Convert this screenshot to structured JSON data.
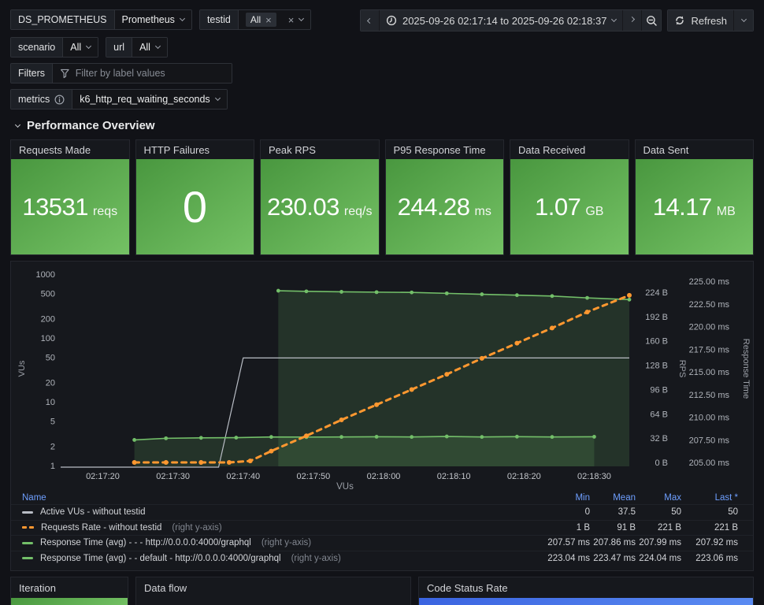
{
  "header": {
    "ds_label": "DS_PROMETHEUS",
    "ds_value": "Prometheus",
    "testid_label": "testid",
    "testid_chip": "All",
    "scenario_label": "scenario",
    "scenario_value": "All",
    "url_label": "url",
    "url_value": "All",
    "filters_label": "Filters",
    "filters_placeholder": "Filter by label values",
    "metrics_label": "metrics",
    "metrics_value": "k6_http_req_waiting_seconds",
    "time_range": "2025-09-26 02:17:14 to 2025-09-26 02:18:37",
    "refresh_label": "Refresh"
  },
  "section": {
    "title": "Performance Overview"
  },
  "stats": [
    {
      "title": "Requests Made",
      "value": "13531",
      "unit": "reqs"
    },
    {
      "title": "HTTP Failures",
      "value": "0",
      "unit": ""
    },
    {
      "title": "Peak RPS",
      "value": "230.03",
      "unit": "req/s"
    },
    {
      "title": "P95 Response Time",
      "value": "244.28",
      "unit": "ms"
    },
    {
      "title": "Data Received",
      "value": "1.07",
      "unit": "GB"
    },
    {
      "title": "Data Sent",
      "value": "14.17",
      "unit": "MB"
    }
  ],
  "chart_data": {
    "type": "line",
    "x_axis": {
      "start": "02:17:14",
      "end": "02:18:35",
      "duration_seconds": 81,
      "tick_labels": [
        "02:17:20",
        "02:17:30",
        "02:17:40",
        "02:17:50",
        "02:18:00",
        "02:18:10",
        "02:18:20",
        "02:18:30"
      ],
      "tick_seconds": [
        6,
        16,
        26,
        36,
        46,
        56,
        66,
        76
      ],
      "title": "VUs"
    },
    "left_axis": {
      "title": "VUs",
      "scale": "log",
      "tick_values": [
        1000,
        500,
        200,
        100,
        50,
        20,
        10,
        5,
        2,
        1
      ],
      "max_value": 1120
    },
    "rps_axis": {
      "title": "RPS",
      "tick_labels": [
        "224 B",
        "192 B",
        "160 B",
        "128 B",
        "96 B",
        "64 B",
        "32 B",
        "0 B"
      ],
      "tick_values": [
        224,
        192,
        160,
        128,
        96,
        64,
        32,
        0
      ]
    },
    "ms_axis": {
      "title": "Response Time",
      "tick_labels": [
        "225.00 ms",
        "222.50 ms",
        "220.00 ms",
        "217.50 ms",
        "215.00 ms",
        "212.50 ms",
        "210.00 ms",
        "207.50 ms",
        "205.00 ms"
      ],
      "tick_values": [
        225,
        222.5,
        220,
        217.5,
        215,
        212.5,
        210,
        207.5,
        205
      ],
      "min": 205
    },
    "series": [
      {
        "name": "Active VUs - without testid",
        "axis": "vus",
        "color": "#b9bdc5",
        "style": "line",
        "width": 1.2,
        "points": [
          [
            0,
            0
          ],
          [
            22.5,
            0
          ],
          [
            26,
            50
          ],
          [
            81,
            50
          ]
        ]
      },
      {
        "name": "Requests Rate - without testid",
        "axis": "rps",
        "color": "#ff9830",
        "style": "dashed",
        "width": 3,
        "points": [
          [
            10.5,
            1
          ],
          [
            15,
            1
          ],
          [
            20,
            1
          ],
          [
            24,
            1
          ],
          [
            27,
            3
          ],
          [
            30,
            16
          ],
          [
            35,
            36
          ],
          [
            40,
            57
          ],
          [
            45,
            77
          ],
          [
            50,
            97
          ],
          [
            55,
            117
          ],
          [
            60,
            138
          ],
          [
            65,
            158
          ],
          [
            70,
            178
          ],
          [
            75,
            199
          ],
          [
            81,
            221
          ]
        ]
      },
      {
        "name": "Response Time (avg) - - - http://0.0.0.0:4000/graphql",
        "axis": "ms",
        "color": "#73bf69",
        "style": "area",
        "width": 1.6,
        "fill_opacity": 0.16,
        "points": [
          [
            10.5,
            207.57
          ],
          [
            15,
            207.75
          ],
          [
            20,
            207.8
          ],
          [
            25,
            207.82
          ],
          [
            30,
            207.9
          ],
          [
            35,
            207.88
          ],
          [
            40,
            207.9
          ],
          [
            45,
            207.92
          ],
          [
            50,
            207.9
          ],
          [
            55,
            207.95
          ],
          [
            60,
            207.9
          ],
          [
            65,
            207.93
          ],
          [
            70,
            207.9
          ],
          [
            76,
            207.92
          ]
        ]
      },
      {
        "name": "Response Time (avg) - - default - http://0.0.0.0:4000/graphql",
        "axis": "ms",
        "color": "#73bf69",
        "style": "area",
        "width": 1.6,
        "fill_opacity": 0.16,
        "points": [
          [
            31,
            224.04
          ],
          [
            35,
            223.97
          ],
          [
            40,
            223.92
          ],
          [
            45,
            223.88
          ],
          [
            50,
            223.85
          ],
          [
            55,
            223.75
          ],
          [
            60,
            223.65
          ],
          [
            65,
            223.55
          ],
          [
            70,
            223.45
          ],
          [
            75,
            223.25
          ],
          [
            81,
            223.06
          ]
        ]
      }
    ]
  },
  "legend": {
    "columns": {
      "name": "Name",
      "min": "Min",
      "mean": "Mean",
      "max": "Max",
      "last": "Last *"
    },
    "rows": [
      {
        "swatch": "gray-line",
        "name": "Active VUs - without testid",
        "suffix": "",
        "min": "0",
        "mean": "37.5",
        "max": "50",
        "last": "50"
      },
      {
        "swatch": "orange-dash",
        "name": "Requests Rate - without testid",
        "suffix": "(right y-axis)",
        "min": "1 B",
        "mean": "91 B",
        "max": "221 B",
        "last": "221 B"
      },
      {
        "swatch": "green-line",
        "name": "Response Time (avg) - - - http://0.0.0.0:4000/graphql",
        "suffix": "(right y-axis)",
        "min": "207.57 ms",
        "mean": "207.86 ms",
        "max": "207.99 ms",
        "last": "207.92 ms"
      },
      {
        "swatch": "green-line",
        "name": "Response Time (avg) - - default - http://0.0.0.0:4000/graphql",
        "suffix": "(right y-axis)",
        "min": "223.04 ms",
        "mean": "223.47 ms",
        "max": "224.04 ms",
        "last": "223.06 ms"
      }
    ]
  },
  "bottom_panels": [
    {
      "title": "Iteration",
      "bar": "green"
    },
    {
      "title": "Data flow",
      "bar": "none"
    },
    {
      "title": "Code Status Rate",
      "bar": "blue"
    }
  ],
  "colors": {
    "page_bg": "#111217",
    "panel_bg": "#16181d",
    "green_series": "#73bf69",
    "orange_series": "#ff9830",
    "gray_series": "#b9bdc5",
    "legend_header_blue": "#6e9fff",
    "stat_gradient_from": "#49973f",
    "stat_gradient_to": "#74c164",
    "blue_bar": "#3a63e0"
  }
}
